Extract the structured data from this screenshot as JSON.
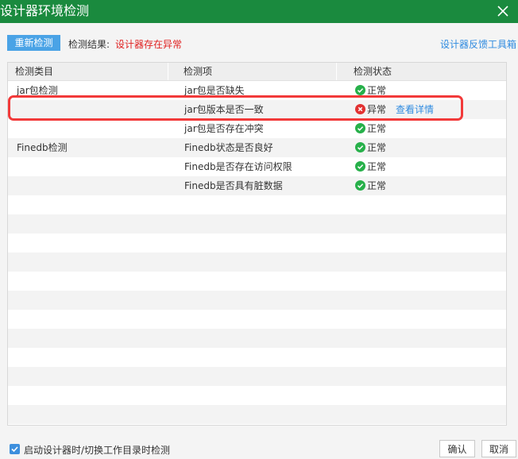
{
  "window": {
    "title": "设计器环境检测"
  },
  "toolbar": {
    "recheck_label": "重新检测",
    "result_label": "检测结果:",
    "result_value": "设计器存在异常",
    "feedback_link": "设计器反馈工具箱"
  },
  "table": {
    "headers": [
      "检测类目",
      "检测项",
      "检测状态"
    ],
    "rows": [
      {
        "category": "jar包检测",
        "item": "jar包是否缺失",
        "status": "正常",
        "ok": true
      },
      {
        "category": "",
        "item": "jar包版本是否一致",
        "status": "异常",
        "ok": false,
        "detail": "查看详情"
      },
      {
        "category": "",
        "item": "jar包是否存在冲突",
        "status": "正常",
        "ok": true
      },
      {
        "category": "Finedb检测",
        "item": "Finedb状态是否良好",
        "status": "正常",
        "ok": true
      },
      {
        "category": "",
        "item": "Finedb是否存在访问权限",
        "status": "正常",
        "ok": true
      },
      {
        "category": "",
        "item": "Finedb是否具有脏数据",
        "status": "正常",
        "ok": true
      }
    ],
    "empty_rows": 12
  },
  "colors": {
    "ok": "#27b04a",
    "error": "#e23232",
    "accent": "#2f8be0",
    "titlebar": "#1a8a3e"
  },
  "icons": {
    "ok": "check-circle-icon",
    "error": "x-circle-icon",
    "close": "close-icon"
  },
  "footer": {
    "checkbox_label": "启动设计器时/切换工作目录时检测",
    "checkbox_checked": true,
    "ok_label": "确认",
    "cancel_label": "取消"
  }
}
